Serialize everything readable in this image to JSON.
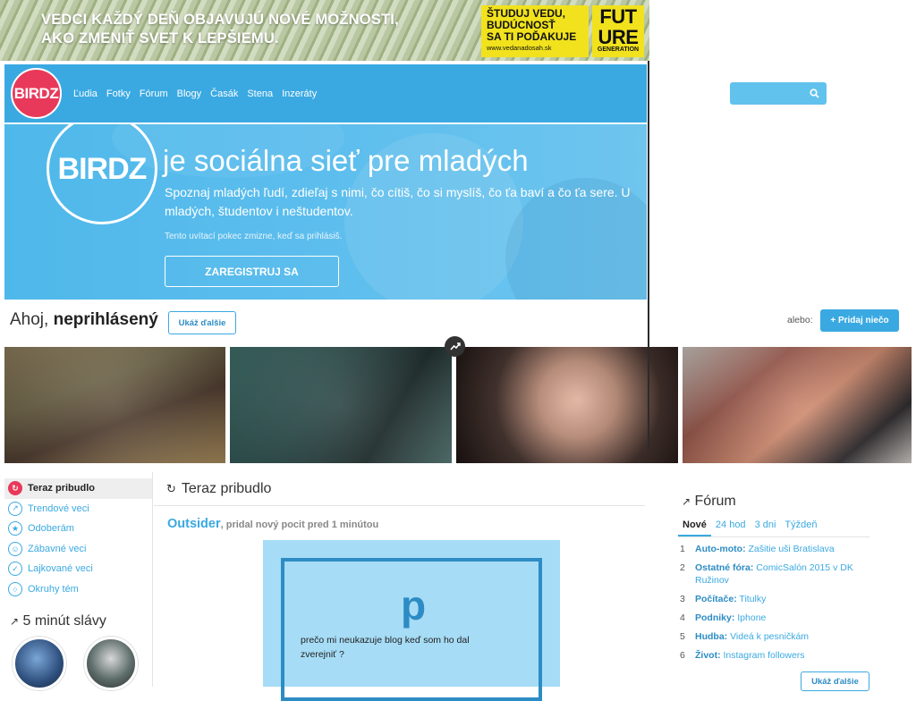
{
  "ad": {
    "line1": "VEDCI KAŽDÝ DEŇ OBJAVUJÚ NOVÉ MOŽNOSTI,",
    "line2": "AKO ZMENIŤ SVET K LEPŠIEMU.",
    "cta_line1": "ŠTUDUJ VEDU,",
    "cta_line2": "BUDÚCNOSŤ",
    "cta_line3": "SA TI POĎAKUJE",
    "url": "www.vedanadosah.sk",
    "future_top": "FUT",
    "future_mid": "URE",
    "future_bottom": "GENERATION"
  },
  "header": {
    "logo": "BIRDZ",
    "nav": [
      "Ľudia",
      "Fotky",
      "Fórum",
      "Blogy",
      "Časák",
      "Stena",
      "Inzeráty"
    ],
    "search_placeholder": "",
    "search_icon": "search-icon"
  },
  "hero": {
    "logo": "BIRDZ",
    "title": "je sociálna sieť pre mladých",
    "subtitle": "Spoznaj mladých ľudí, zdieľaj s nimi, čo cítiš, čo si myslíš, čo ťa baví a čo ťa sere. U mladých, študentov i neštudentov.",
    "note": "Tento uvítací pokec zmizne, keď sa prihlásiš.",
    "register": "ZAREGISTRUJ SA"
  },
  "greeting": {
    "hello": "Ahoj, ",
    "name": "neprihlásený",
    "show_more": "Ukáž ďalšie"
  },
  "actions": {
    "or": "alebo:",
    "add": "+ Pridaj niečo"
  },
  "sidebar": {
    "items": [
      {
        "label": "Teraz pribudlo",
        "icon": "refresh-icon",
        "active": true
      },
      {
        "label": "Trendové veci",
        "icon": "trending-icon",
        "active": false
      },
      {
        "label": "Odoberám",
        "icon": "star-icon",
        "active": false
      },
      {
        "label": "Zábavné veci",
        "icon": "smile-icon",
        "active": false
      },
      {
        "label": "Lajkované veci",
        "icon": "thumbs-up-icon",
        "active": false
      },
      {
        "label": "Okruhy tém",
        "icon": "circle-icon",
        "active": false
      }
    ],
    "fame_title": "5 minút slávy"
  },
  "feed": {
    "title": "Teraz pribudlo",
    "post": {
      "user": "Outsider",
      "meta": ", pridal nový pocit pred 1 minútou",
      "letter": "p",
      "text": "prečo mi neukazuje blog keď som ho dal zverejniť ?"
    }
  },
  "forum": {
    "title": "Fórum",
    "tabs": [
      "Nové",
      "24 hod",
      "3 dni",
      "Týždeň"
    ],
    "items": [
      {
        "num": "1",
        "category": "Auto-moto:",
        "topic": "Zašitie uši Bratislava"
      },
      {
        "num": "2",
        "category": "Ostatné fóra:",
        "topic": "ComicSalón 2015 v DK Ružinov"
      },
      {
        "num": "3",
        "category": "Počítače:",
        "topic": "Titulky"
      },
      {
        "num": "4",
        "category": "Podniky:",
        "topic": "Iphone"
      },
      {
        "num": "5",
        "category": "Hudba:",
        "topic": "Videá k pesničkám"
      },
      {
        "num": "6",
        "category": "Život:",
        "topic": "Instagram followers"
      }
    ],
    "show_more": "Ukáž ďalšie"
  },
  "colors": {
    "brand_blue": "#3aa9e2",
    "brand_pink": "#e8395b",
    "ad_yellow": "#f1e21d"
  }
}
